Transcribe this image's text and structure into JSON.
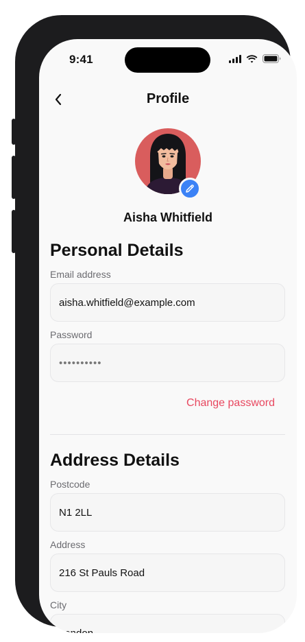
{
  "status_bar": {
    "time": "9:41",
    "signal_icon": "cellular-signal-icon",
    "wifi_icon": "wifi-icon",
    "battery_icon": "battery-icon"
  },
  "header": {
    "title": "Profile",
    "back_icon": "chevron-left-icon"
  },
  "profile": {
    "name": "Aisha Whitfield",
    "edit_icon": "pencil-icon"
  },
  "personal_details": {
    "heading": "Personal Details",
    "email_label": "Email address",
    "email_value": "aisha.whitfield@example.com",
    "password_label": "Password",
    "password_value": "••••••••••",
    "change_password": "Change password"
  },
  "address_details": {
    "heading": "Address Details",
    "postcode_label": "Postcode",
    "postcode_value": "N1 2LL",
    "address_label": "Address",
    "address_value": "216 St Pauls Road",
    "city_label": "City",
    "city_value": "London"
  },
  "colors": {
    "accent": "#e8475f",
    "edit_badge": "#3b82f6",
    "avatar_bg": "#d95d5d",
    "screen_bg": "#f9f9f9"
  }
}
